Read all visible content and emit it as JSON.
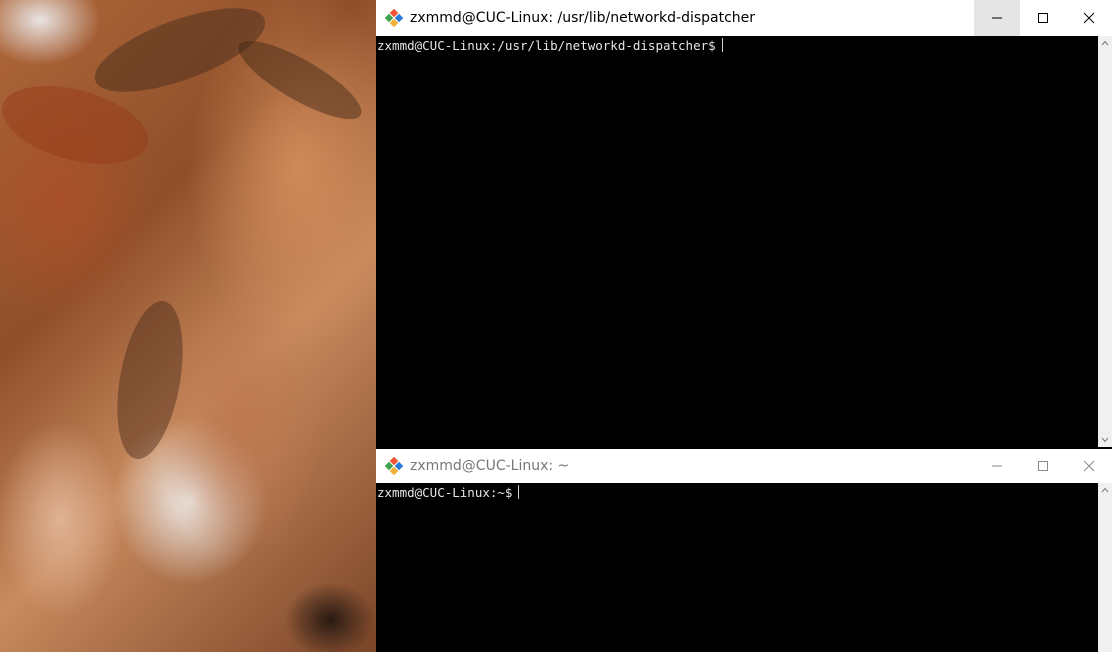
{
  "wallpaper": {
    "icon": "wallpaper-image"
  },
  "windows": {
    "top": {
      "title": "zxmmd@CUC-Linux: /usr/lib/networkd-dispatcher",
      "prompt": "zxmmd@CUC-Linux:/usr/lib/networkd-dispatcher$",
      "icon": "git-icon",
      "active": true
    },
    "bottom": {
      "title": "zxmmd@CUC-Linux: ~",
      "prompt": "zxmmd@CUC-Linux:~$",
      "icon": "git-icon",
      "active": false
    }
  },
  "colors": {
    "terminal_bg": "#000000",
    "terminal_fg": "#e6e6e6",
    "titlebar_bg": "#ffffff",
    "git_orange": "#f05133",
    "git_green": "#3fa34d",
    "git_blue": "#2b7bd6",
    "git_yellow": "#f2b134"
  }
}
